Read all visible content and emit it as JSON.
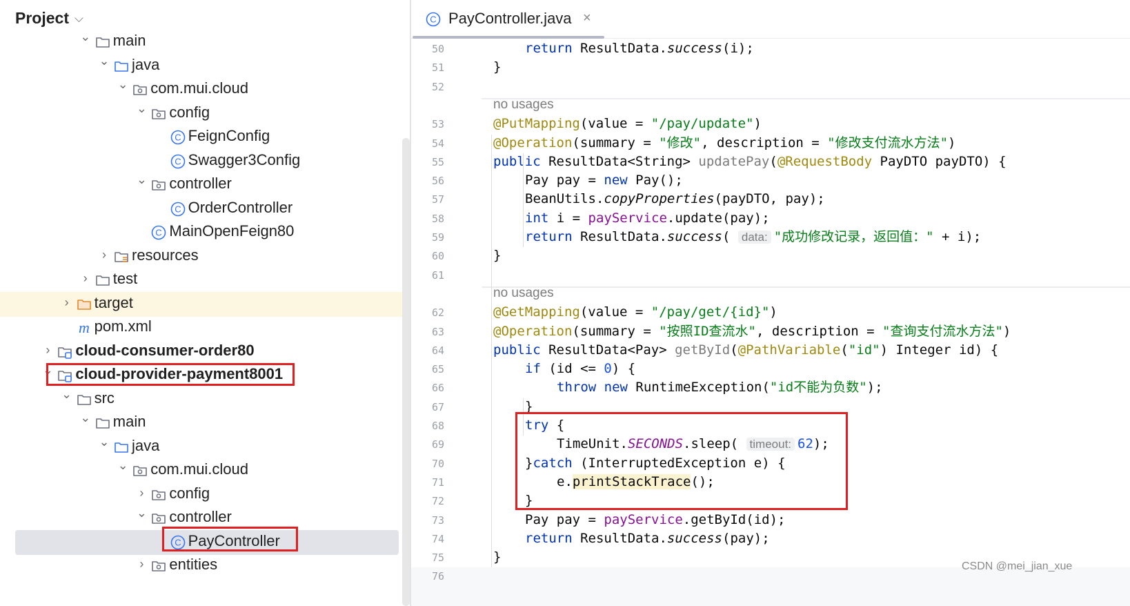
{
  "project_panel": {
    "title": "Project",
    "tree": [
      {
        "label": "main",
        "icon": "folder-icon",
        "toggle": "expanded",
        "indent": 4
      },
      {
        "label": "java",
        "icon": "source-folder-icon",
        "toggle": "expanded",
        "indent": 5
      },
      {
        "label": "com.mui.cloud",
        "icon": "package-icon",
        "toggle": "expanded",
        "indent": 6
      },
      {
        "label": "config",
        "icon": "package-icon",
        "toggle": "expanded",
        "indent": 7
      },
      {
        "label": "FeignConfig",
        "icon": "java-class-icon",
        "toggle": "none",
        "indent": 8
      },
      {
        "label": "Swagger3Config",
        "icon": "java-class-icon",
        "toggle": "none",
        "indent": 8
      },
      {
        "label": "controller",
        "icon": "package-icon",
        "toggle": "expanded",
        "indent": 7
      },
      {
        "label": "OrderController",
        "icon": "java-class-icon",
        "toggle": "none",
        "indent": 8
      },
      {
        "label": "MainOpenFeign80",
        "icon": "java-class-icon",
        "toggle": "none",
        "indent": 7
      },
      {
        "label": "resources",
        "icon": "resources-folder-icon",
        "toggle": "collapsed",
        "indent": 5
      },
      {
        "label": "test",
        "icon": "folder-icon",
        "toggle": "collapsed",
        "indent": 4
      },
      {
        "label": "target",
        "icon": "excluded-folder-icon",
        "toggle": "collapsed",
        "indent": 3,
        "highlight": "selected"
      },
      {
        "label": "pom.xml",
        "icon": "maven-icon",
        "toggle": "none",
        "indent": 3
      },
      {
        "label": "cloud-consumer-order80",
        "icon": "module-icon",
        "toggle": "collapsed",
        "indent": 2,
        "bold": true
      },
      {
        "label": "cloud-provider-payment8001",
        "icon": "module-icon",
        "toggle": "expanded",
        "indent": 2,
        "bold": true,
        "boxed": true
      },
      {
        "label": "src",
        "icon": "folder-icon",
        "toggle": "expanded",
        "indent": 3
      },
      {
        "label": "main",
        "icon": "folder-icon",
        "toggle": "expanded",
        "indent": 4
      },
      {
        "label": "java",
        "icon": "source-folder-icon",
        "toggle": "expanded",
        "indent": 5
      },
      {
        "label": "com.mui.cloud",
        "icon": "package-icon",
        "toggle": "expanded",
        "indent": 6
      },
      {
        "label": "config",
        "icon": "package-icon",
        "toggle": "collapsed",
        "indent": 7
      },
      {
        "label": "controller",
        "icon": "package-icon",
        "toggle": "expanded",
        "indent": 7
      },
      {
        "label": "PayController",
        "icon": "java-class-icon",
        "toggle": "none",
        "indent": 8,
        "highlight": "active",
        "boxed": true
      },
      {
        "label": "entities",
        "icon": "package-icon",
        "toggle": "collapsed",
        "indent": 7
      }
    ]
  },
  "editor": {
    "tab": {
      "label": "PayController.java",
      "close_glyph": "×",
      "icon": "java-class-icon"
    },
    "colors": {
      "keyword": "#0033b3",
      "string": "#067d17",
      "annotation": "#9e880d",
      "field": "#871094",
      "highlight_box": "#e02020"
    },
    "usage_text": "no usages",
    "lines": [
      {
        "num": "50",
        "indent": 2,
        "tokens": [
          {
            "t": "return",
            "c": "kw"
          },
          {
            "t": " ResultData."
          },
          {
            "t": "success",
            "c": "ital"
          },
          {
            "t": "(i);"
          }
        ]
      },
      {
        "num": "51",
        "indent": 1,
        "tokens": [
          {
            "t": "}"
          }
        ]
      },
      {
        "num": "52",
        "indent": 0,
        "tokens": [],
        "separator_after": true
      },
      {
        "usage": true,
        "indent": 1
      },
      {
        "num": "53",
        "indent": 1,
        "tokens": [
          {
            "t": "@PutMapping",
            "c": "ann"
          },
          {
            "t": "(value = "
          },
          {
            "t": "\"/pay/update\"",
            "c": "str"
          },
          {
            "t": ")"
          }
        ]
      },
      {
        "num": "54",
        "indent": 1,
        "tokens": [
          {
            "t": "@Operation",
            "c": "ann"
          },
          {
            "t": "(summary = "
          },
          {
            "t": "\"修改\"",
            "c": "str"
          },
          {
            "t": ", description = "
          },
          {
            "t": "\"修改支付流水方法\"",
            "c": "str"
          },
          {
            "t": ")"
          }
        ]
      },
      {
        "num": "55",
        "indent": 1,
        "tokens": [
          {
            "t": "public",
            "c": "kw"
          },
          {
            "t": " ResultData<String> "
          },
          {
            "t": "updatePay",
            "c": "unused"
          },
          {
            "t": "("
          },
          {
            "t": "@RequestBody",
            "c": "ann"
          },
          {
            "t": " PayDTO payDTO) {"
          }
        ]
      },
      {
        "num": "56",
        "indent": 2,
        "tokens": [
          {
            "t": "Pay pay = "
          },
          {
            "t": "new",
            "c": "kw"
          },
          {
            "t": " Pay();"
          }
        ]
      },
      {
        "num": "57",
        "indent": 2,
        "tokens": [
          {
            "t": "BeanUtils."
          },
          {
            "t": "copyProperties",
            "c": "ital"
          },
          {
            "t": "(payDTO, pay);"
          }
        ]
      },
      {
        "num": "58",
        "indent": 2,
        "tokens": [
          {
            "t": "int",
            "c": "kw"
          },
          {
            "t": " i = "
          },
          {
            "t": "payService",
            "c": "field"
          },
          {
            "t": ".update(pay);"
          }
        ]
      },
      {
        "num": "59",
        "indent": 2,
        "tokens": [
          {
            "t": "return",
            "c": "kw"
          },
          {
            "t": " ResultData."
          },
          {
            "t": "success",
            "c": "ital"
          },
          {
            "t": "( "
          },
          {
            "t": "data:",
            "c": "hint"
          },
          {
            "t": "\"成功修改记录，返回值：\"",
            "c": "str"
          },
          {
            "t": " + i);"
          }
        ]
      },
      {
        "num": "60",
        "indent": 1,
        "tokens": [
          {
            "t": "}"
          }
        ]
      },
      {
        "num": "61",
        "indent": 0,
        "tokens": [],
        "separator_after": true
      },
      {
        "usage": true,
        "indent": 1
      },
      {
        "num": "62",
        "indent": 1,
        "tokens": [
          {
            "t": "@GetMapping",
            "c": "ann"
          },
          {
            "t": "(value = "
          },
          {
            "t": "\"/pay/get/{id}\"",
            "c": "str"
          },
          {
            "t": ")"
          }
        ]
      },
      {
        "num": "63",
        "indent": 1,
        "tokens": [
          {
            "t": "@Operation",
            "c": "ann"
          },
          {
            "t": "(summary = "
          },
          {
            "t": "\"按照ID查流水\"",
            "c": "str"
          },
          {
            "t": ", description = "
          },
          {
            "t": "\"查询支付流水方法\"",
            "c": "str"
          },
          {
            "t": ")"
          }
        ]
      },
      {
        "num": "64",
        "indent": 1,
        "tokens": [
          {
            "t": "public",
            "c": "kw"
          },
          {
            "t": " ResultData<Pay> "
          },
          {
            "t": "getById",
            "c": "unused"
          },
          {
            "t": "("
          },
          {
            "t": "@PathVariable",
            "c": "ann"
          },
          {
            "t": "("
          },
          {
            "t": "\"id\"",
            "c": "str"
          },
          {
            "t": ") Integer id) {"
          }
        ]
      },
      {
        "num": "65",
        "indent": 2,
        "tokens": [
          {
            "t": "if",
            "c": "kw"
          },
          {
            "t": " (id <= "
          },
          {
            "t": "0",
            "c": "num"
          },
          {
            "t": ") {"
          }
        ]
      },
      {
        "num": "66",
        "indent": 3,
        "tokens": [
          {
            "t": "throw",
            "c": "kw"
          },
          {
            "t": " "
          },
          {
            "t": "new",
            "c": "kw"
          },
          {
            "t": " RuntimeException("
          },
          {
            "t": "\"id不能为负数\"",
            "c": "str"
          },
          {
            "t": ");"
          }
        ]
      },
      {
        "num": "67",
        "indent": 2,
        "tokens": [
          {
            "t": "}"
          }
        ]
      },
      {
        "num": "68",
        "indent": 2,
        "tokens": [
          {
            "t": "try",
            "c": "kw"
          },
          {
            "t": " {"
          }
        ]
      },
      {
        "num": "69",
        "indent": 3,
        "tokens": [
          {
            "t": "TimeUnit."
          },
          {
            "t": "SECONDS",
            "c": "const"
          },
          {
            "t": ".sleep( "
          },
          {
            "t": "timeout:",
            "c": "hint"
          },
          {
            "t": "62",
            "c": "num"
          },
          {
            "t": ");"
          }
        ]
      },
      {
        "num": "70",
        "indent": 2,
        "tokens": [
          {
            "t": "}"
          },
          {
            "t": "catch",
            "c": "kw"
          },
          {
            "t": " (InterruptedException e) {"
          }
        ]
      },
      {
        "num": "71",
        "indent": 3,
        "tokens": [
          {
            "t": "e."
          },
          {
            "t": "printStackTrace",
            "c": "hl"
          },
          {
            "t": "();"
          }
        ]
      },
      {
        "num": "72",
        "indent": 2,
        "tokens": [
          {
            "t": "}"
          }
        ]
      },
      {
        "num": "73",
        "indent": 2,
        "tokens": [
          {
            "t": "Pay pay = "
          },
          {
            "t": "payService",
            "c": "field"
          },
          {
            "t": ".getById(id);"
          }
        ]
      },
      {
        "num": "74",
        "indent": 2,
        "tokens": [
          {
            "t": "return",
            "c": "kw"
          },
          {
            "t": " ResultData."
          },
          {
            "t": "success",
            "c": "ital"
          },
          {
            "t": "(pay);"
          }
        ]
      },
      {
        "num": "75",
        "indent": 1,
        "tokens": [
          {
            "t": "}"
          }
        ]
      },
      {
        "num": "76",
        "indent": 0,
        "tokens": []
      }
    ]
  },
  "watermark": "CSDN @mei_jian_xue"
}
